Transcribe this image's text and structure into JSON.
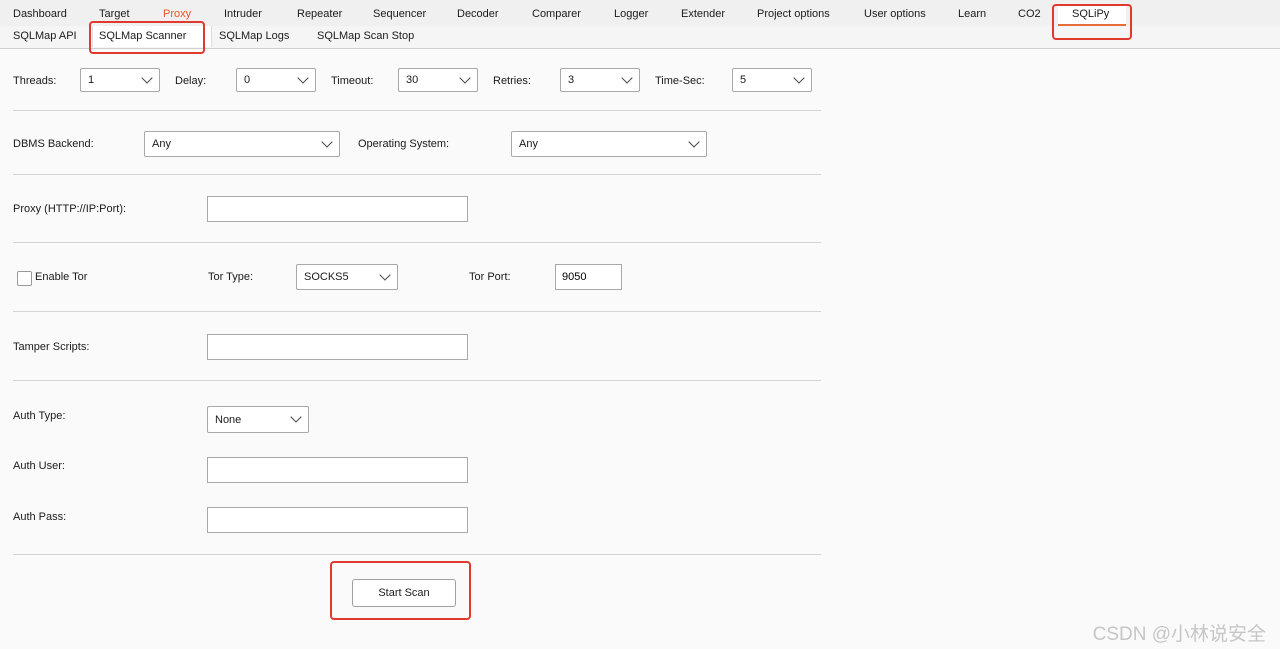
{
  "top_tabs": [
    "Dashboard",
    "Target",
    "Proxy",
    "Intruder",
    "Repeater",
    "Sequencer",
    "Decoder",
    "Comparer",
    "Logger",
    "Extender",
    "Project options",
    "User options",
    "Learn",
    "CO2",
    "SQLiPy"
  ],
  "sub_tabs": [
    "SQLMap API",
    "SQLMap Scanner",
    "SQLMap Logs",
    "SQLMap Scan Stop"
  ],
  "form": {
    "threads_label": "Threads:",
    "threads_value": "1",
    "delay_label": "Delay:",
    "delay_value": "0",
    "timeout_label": "Timeout:",
    "timeout_value": "30",
    "retries_label": "Retries:",
    "retries_value": "3",
    "timesec_label": "Time-Sec:",
    "timesec_value": "5",
    "dbms_label": "DBMS Backend:",
    "dbms_value": "Any",
    "os_label": "Operating System:",
    "os_value": "Any",
    "proxy_label": "Proxy (HTTP://IP:Port):",
    "proxy_value": "",
    "tor_label": "Enable Tor",
    "tor_type_label": "Tor Type:",
    "tor_type_value": "SOCKS5",
    "tor_port_label": "Tor Port:",
    "tor_port_value": "9050",
    "tamper_label": "Tamper Scripts:",
    "tamper_value": "",
    "auth_type_label": "Auth Type:",
    "auth_type_value": "None",
    "auth_user_label": "Auth User:",
    "auth_user_value": "",
    "auth_pass_label": "Auth Pass:",
    "auth_pass_value": "",
    "start_scan": "Start Scan"
  },
  "watermark": "CSDN @小林说安全",
  "colors": {
    "highlight": "#e03a2f",
    "active_tab_text": "#e8572a"
  }
}
